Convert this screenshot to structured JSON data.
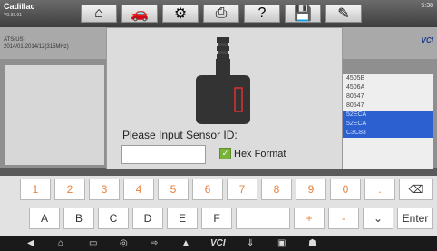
{
  "header": {
    "vehicle": "Cadillac",
    "version": "V0.99.01",
    "toolbar_icons": [
      "home-icon",
      "vehicle-icon",
      "settings-icon",
      "print-icon",
      "help-icon",
      "save-icon",
      "edit-icon"
    ]
  },
  "subheader": {
    "line1": "ATS(US)",
    "line2": "2014/01-2014/12(315MHz)",
    "right_label": "VCI",
    "right_btn": "n"
  },
  "sensor_list": [
    "4505B",
    "4506A",
    "80547",
    "80547",
    "52ECA",
    "52ECA",
    "C3C83"
  ],
  "dialog": {
    "prompt": "Please Input Sensor ID:",
    "input_value": "",
    "hex_label": "Hex Format",
    "hex_checked": true
  },
  "keyboard": {
    "row1": [
      "1",
      "2",
      "3",
      "4",
      "5",
      "6",
      "7",
      "8",
      "9",
      "0",
      "."
    ],
    "row2": [
      "A",
      "B",
      "C",
      "D",
      "E",
      "F"
    ],
    "plus": "+",
    "minus": "-",
    "enter": "Enter"
  },
  "navbar": {
    "vci_label": "VCI",
    "time": "5:38"
  }
}
